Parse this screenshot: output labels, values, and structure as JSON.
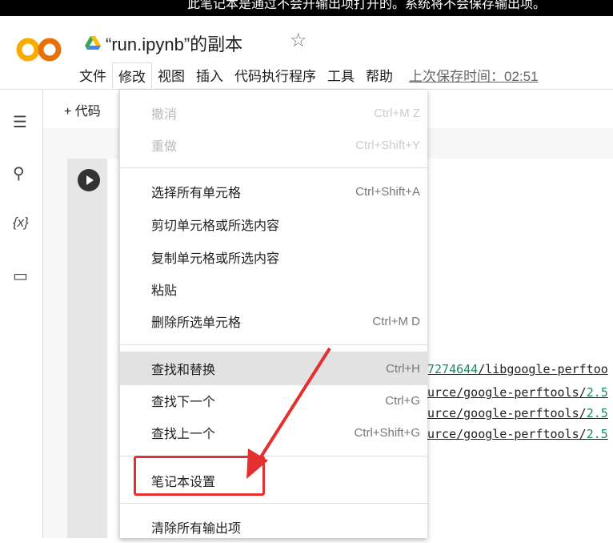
{
  "banner": {
    "text": "此笔记本是通过不会开输出项打开的。系统将不会保存输出项。"
  },
  "header": {
    "title": "“run.ipynb”的副本",
    "logo": "CO",
    "star_icon": "star-icon",
    "drive_icon": "google-drive-icon"
  },
  "menubar": {
    "items": [
      "文件",
      "修改",
      "视图",
      "插入",
      "代码执行程序",
      "工具",
      "帮助"
    ],
    "active": "修改",
    "last_saved": "上次保存时间：02:51"
  },
  "toolbar": {
    "add_code": "+ 代码"
  },
  "sidebar": {
    "icons": [
      "toc-icon",
      "search-icon",
      "variables-icon",
      "folder-icon"
    ],
    "variables_label": "{x}"
  },
  "edit_menu": {
    "items": [
      {
        "label": "撤消",
        "shortcut": "Ctrl+M Z",
        "disabled": true
      },
      {
        "label": "重做",
        "shortcut": "Ctrl+Shift+Y",
        "disabled": true
      },
      {
        "label": "选择所有单元格",
        "shortcut": "Ctrl+Shift+A"
      },
      {
        "label": "剪切单元格或所选内容",
        "shortcut": ""
      },
      {
        "label": "复制单元格或所选内容",
        "shortcut": ""
      },
      {
        "label": "粘贴",
        "shortcut": ""
      },
      {
        "label": "删除所选单元格",
        "shortcut": "Ctrl+M D"
      },
      {
        "label": "查找和替换",
        "shortcut": "Ctrl+H",
        "highlighted": true
      },
      {
        "label": "查找下一个",
        "shortcut": "Ctrl+G"
      },
      {
        "label": "查找上一个",
        "shortcut": "Ctrl+Shift+G"
      },
      {
        "label": "笔记本设置",
        "shortcut": ""
      },
      {
        "label": "清除所有输出项",
        "shortcut": ""
      }
    ]
  },
  "output": {
    "lines": [
      {
        "pre": "",
        "green": "7274644",
        "post": "/libgoogle-perftoo"
      },
      {
        "pre": "urce/google-perftools/",
        "green": "2.5",
        "post": ""
      },
      {
        "pre": "urce/google-perftools/",
        "green": "2.5",
        "post": ""
      },
      {
        "pre": "urce/google-perftools/",
        "green": "2.5",
        "post": ""
      }
    ]
  },
  "annotation": {
    "color": "#e53030"
  }
}
